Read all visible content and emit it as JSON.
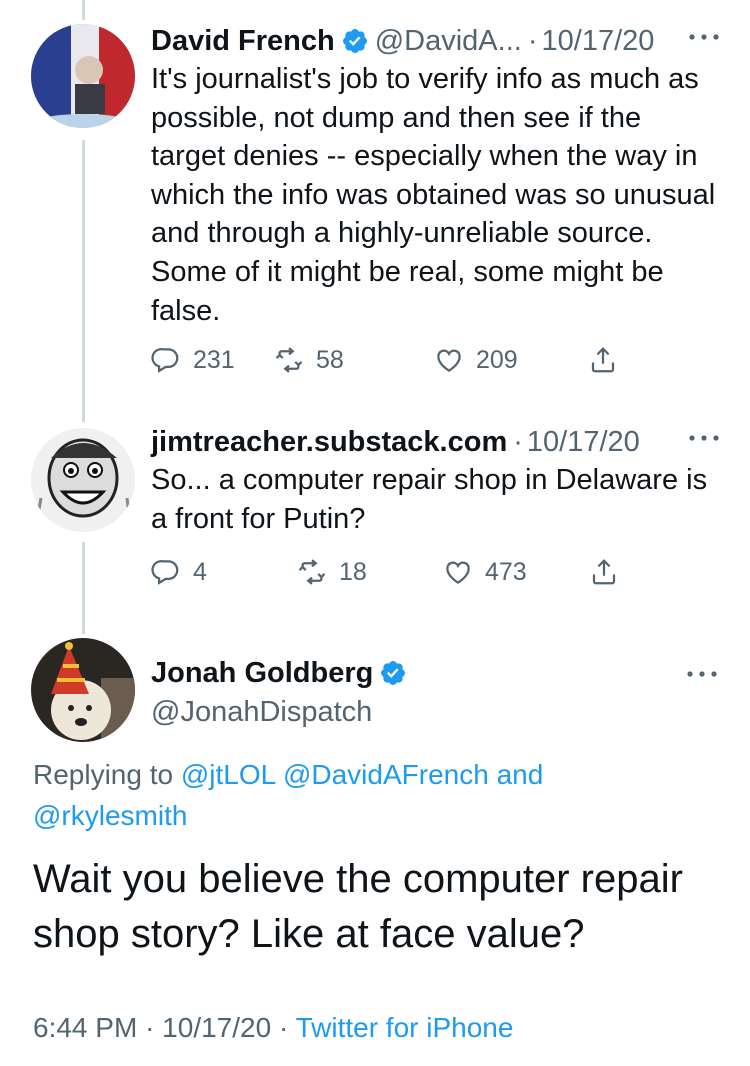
{
  "colors": {
    "accent": "#1d9bf0",
    "muted": "#536471",
    "text": "#0f1419",
    "thread_line": "#cfd9de"
  },
  "tweets": [
    {
      "name": "David French",
      "verified": true,
      "handle": "@DavidA...",
      "dot": "·",
      "date": "10/17/20",
      "text": "It's journalist's job to verify info as much as possible, not dump and then see if the target denies -- especially when the way in which the info was obtained was so unusual and through a highly-unreliable source. Some of it might be real, some might be false.",
      "replies": "231",
      "retweets": "58",
      "likes": "209"
    },
    {
      "name": "jimtreacher.substack.com",
      "verified": false,
      "dot": "·",
      "date": "10/17/20",
      "text": "So... a computer repair shop in Delaware is a front for Putin?",
      "replies": "4",
      "retweets": "18",
      "likes": "473"
    }
  ],
  "main_tweet": {
    "name": "Jonah Goldberg",
    "verified": true,
    "handle": "@JonahDispatch",
    "replying_prefix": "Replying to",
    "mention_1": "@jtLOL",
    "mention_2": "@DavidAFrench",
    "replying_and": "and",
    "mention_3": "@rkylesmith",
    "text": "Wait you believe the computer repair shop story? Like at face value?",
    "time": "6:44 PM",
    "dot1": "·",
    "date": "10/17/20",
    "dot2": "·",
    "client": "Twitter for iPhone"
  }
}
